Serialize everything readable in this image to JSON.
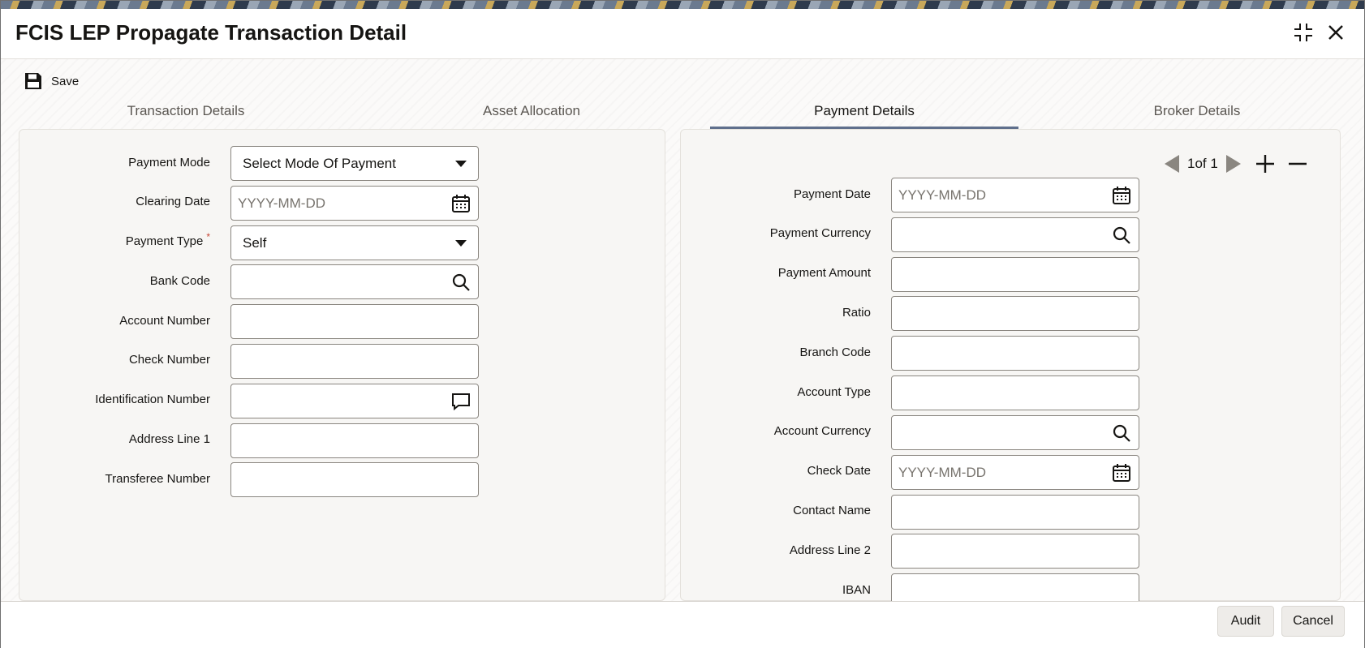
{
  "window": {
    "title": "FCIS LEP Propagate Transaction Detail"
  },
  "toolbar": {
    "save_label": "Save"
  },
  "tabs": [
    {
      "label": "Transaction Details"
    },
    {
      "label": "Asset Allocation"
    },
    {
      "label": "Payment Details"
    },
    {
      "label": "Broker Details"
    }
  ],
  "active_tab": "Payment Details",
  "left_form": {
    "payment_mode": {
      "label": "Payment Mode",
      "value": "Select Mode Of Payment"
    },
    "clearing_date": {
      "label": "Clearing Date",
      "placeholder": "YYYY-MM-DD"
    },
    "payment_type": {
      "label": "Payment Type",
      "required_mark": "*",
      "value": "Self"
    },
    "bank_code": {
      "label": "Bank Code"
    },
    "account_number": {
      "label": "Account Number"
    },
    "check_number": {
      "label": "Check Number"
    },
    "identification_number": {
      "label": "Identification Number"
    },
    "address_line_1": {
      "label": "Address Line 1"
    },
    "transferee_number": {
      "label": "Transferee Number"
    }
  },
  "right_form": {
    "pager": {
      "text": "1of 1"
    },
    "payment_date": {
      "label": "Payment Date",
      "placeholder": "YYYY-MM-DD"
    },
    "payment_currency": {
      "label": "Payment Currency"
    },
    "payment_amount": {
      "label": "Payment Amount"
    },
    "ratio": {
      "label": "Ratio"
    },
    "branch_code": {
      "label": "Branch Code"
    },
    "account_type": {
      "label": "Account Type"
    },
    "account_currency": {
      "label": "Account Currency"
    },
    "check_date": {
      "label": "Check Date",
      "placeholder": "YYYY-MM-DD"
    },
    "contact_name": {
      "label": "Contact Name"
    },
    "address_line_2": {
      "label": "Address Line 2"
    },
    "iban": {
      "label": "IBAN"
    }
  },
  "footer": {
    "audit_label": "Audit",
    "cancel_label": "Cancel"
  }
}
